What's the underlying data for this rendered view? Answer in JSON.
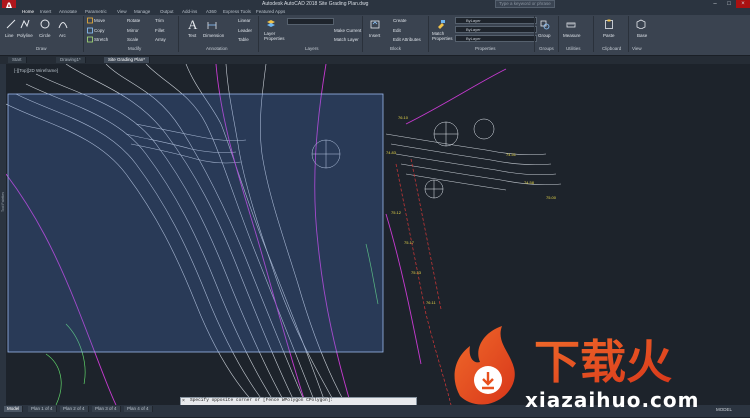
{
  "titlebar": {
    "logo": "A",
    "title": "Autodesk AutoCAD 2018   Site Grading Plan.dwg",
    "search_placeholder": "Type a keyword or phrase"
  },
  "ribbon_tabs": [
    "Home",
    "Insert",
    "Annotate",
    "Parametric",
    "View",
    "Manage",
    "Output",
    "Add-ins",
    "A360",
    "Express Tools",
    "Featured Apps"
  ],
  "ribbon": {
    "draw": {
      "title": "Draw",
      "line": "Line",
      "polyline": "Polyline",
      "circle": "Circle",
      "arc": "Arc"
    },
    "modify": {
      "title": "Modify",
      "move": "Move",
      "rotate": "Rotate",
      "trim": "Trim",
      "copy": "Copy",
      "mirror": "Mirror",
      "fillet": "Fillet",
      "stretch": "Stretch",
      "scale": "Scale",
      "array": "Array"
    },
    "annotation": {
      "title": "Annotation",
      "text": "Text",
      "dimension": "Dimension",
      "linear": "Linear",
      "leader": "Leader",
      "table": "Table"
    },
    "layers": {
      "title": "Layers",
      "layer_properties": "Layer Properties",
      "make_current": "Make Current",
      "match_layer": "Match Layer"
    },
    "block": {
      "title": "Block",
      "insert": "Insert",
      "create": "Create",
      "edit": "Edit",
      "edit_attributes": "Edit Attributes"
    },
    "properties": {
      "title": "Properties",
      "match": "Match Properties",
      "bylayer1": "ByLayer",
      "bylayer2": "ByLayer",
      "bylayer3": "ByLayer"
    },
    "groups": {
      "title": "Groups",
      "group": "Group"
    },
    "utilities": {
      "title": "Utilities",
      "measure": "Measure"
    },
    "clipboard": {
      "title": "Clipboard",
      "paste": "Paste"
    },
    "view": {
      "title": "View",
      "base": "Base"
    }
  },
  "file_tabs": [
    "Start",
    "Drawing1*",
    "Site Grading Plan*"
  ],
  "viewport_label": "[-][Top][2D Wireframe]",
  "nav_palette_label": "Tool Palettes",
  "command": {
    "close": "×",
    "text": "Specify opposite corner or [Fence WPolygon CPolygon]:"
  },
  "layout_tabs": [
    "Model",
    "Plan 1 of 4",
    "Plan 2 of 4",
    "Plan 3 of 4",
    "Plan 4 of 4"
  ],
  "status": {
    "model": "MODEL"
  },
  "watermark": {
    "text": "xiazaihuo.com",
    "brand_cn": "下载火"
  },
  "colors": {
    "accent": "#b0161c",
    "selection": "#4a78c9",
    "contour_white": "#e8eef5",
    "contour_magenta": "#c63ad0",
    "watermark_orange": "#e8501e"
  }
}
